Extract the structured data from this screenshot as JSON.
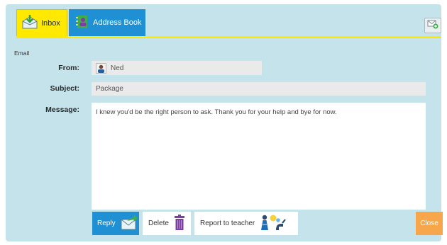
{
  "tabs": {
    "inbox": {
      "label": "Inbox",
      "icon": "inbox-icon"
    },
    "address_book": {
      "label": "Address Book",
      "icon": "address-book-icon"
    }
  },
  "toolbar": {
    "compose_icon": "compose-mail-icon"
  },
  "section": {
    "label": "Email"
  },
  "form": {
    "from_label": "From:",
    "from_value": "Ned",
    "subject_label": "Subject:",
    "subject_value": "Package",
    "message_label": "Message:",
    "message_value": "I knew you'd be the right person to ask. Thank you for your help and bye for now."
  },
  "actions": {
    "reply_label": "Reply",
    "delete_label": "Delete",
    "report_label": "Report to teacher",
    "close_label": "Close"
  },
  "colors": {
    "background": "#c5e3ea",
    "tab_active": "#ffe900",
    "tab_inactive": "#1e90d3",
    "reply_button": "#1e90d3",
    "close_button": "#f7a64b"
  }
}
